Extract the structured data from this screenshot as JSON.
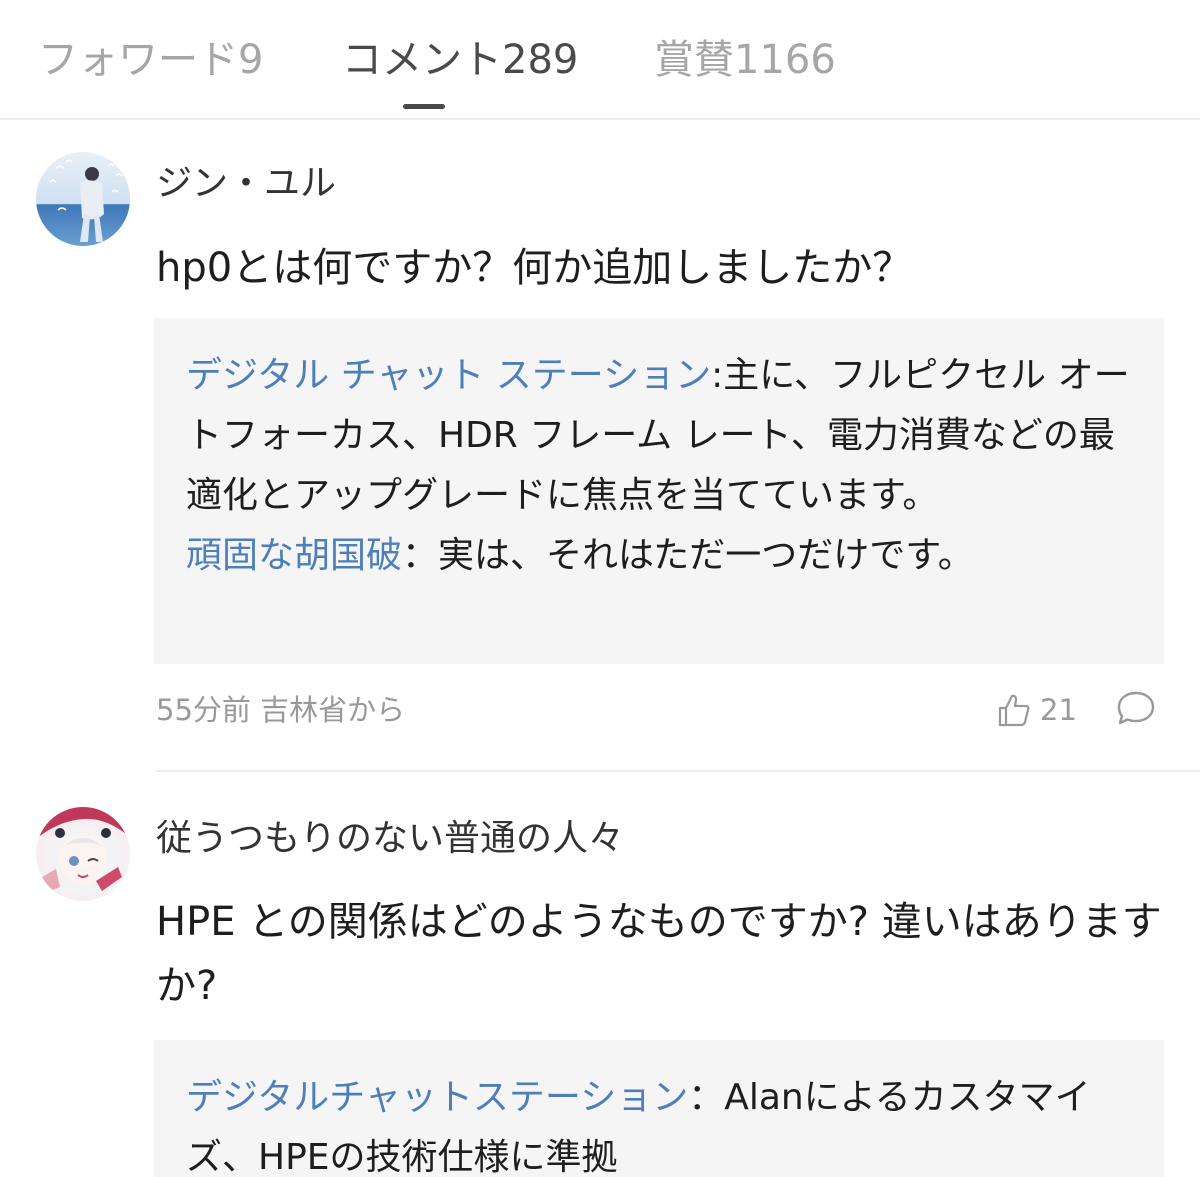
{
  "tabs": [
    {
      "label": "フォワード9"
    },
    {
      "label": "コメント289",
      "active": true
    },
    {
      "label": "賞賛1166"
    }
  ],
  "comments": [
    {
      "author": "ジン・ユル",
      "body": "hp0とは何ですか？何か追加しましたか？",
      "replies": [
        {
          "name": "デジタル チャット ステーション",
          "sep": ":",
          "text": "主に、フルピクセル オートフォーカス、HDR フレーム レート、電力消費などの最適化とアップグレードに焦点を当てています。"
        },
        {
          "name": "頑固な胡国破",
          "sep": "：",
          "text": "実は、それはただ一つだけです。"
        }
      ],
      "meta": "55分前 吉林省から",
      "likes": "21",
      "icons": {
        "like": "thumbs-up-icon",
        "reply": "comment-bubble-icon"
      }
    },
    {
      "author": "従うつもりのない普通の人々",
      "body": "HPE との関係はどのようなものですか? 違いはありますか?",
      "replies": [
        {
          "name": "デジタルチャットステーション",
          "sep": "：",
          "text": "Alanによるカスタマイズ、HPEの技術仕様に準拠"
        }
      ]
    }
  ],
  "colors": {
    "link": "#4f7fb8",
    "reply_bg": "#f5f5f5",
    "muted": "#999999",
    "active_tab": "#4a4a4a",
    "inactive_tab": "#a6a6a6"
  }
}
